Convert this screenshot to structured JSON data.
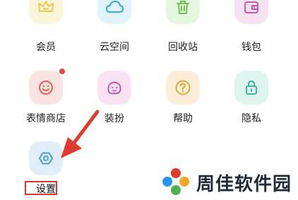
{
  "grid": {
    "row1": [
      {
        "label": "会员",
        "icon": "crown-icon",
        "color": "#e9c84a",
        "bg": "#fbf6d9"
      },
      {
        "label": "云空间",
        "icon": "cloud-icon",
        "color": "#38a7d9",
        "bg": "#e2f4fb"
      },
      {
        "label": "回收站",
        "icon": "trash-icon",
        "color": "#6ec354",
        "bg": "#e6f7df"
      },
      {
        "label": "钱包",
        "icon": "wallet-icon",
        "color": "#c05ab8",
        "bg": "#f6e2f3"
      }
    ],
    "row2": [
      {
        "label": "表情商店",
        "icon": "smiley-icon",
        "color": "#e4605a",
        "bg": "#fbe3e1"
      },
      {
        "label": "装扮",
        "icon": "face-costume-icon",
        "color": "#c35ab2",
        "bg": "#f8e2f3"
      },
      {
        "label": "帮助",
        "icon": "question-icon",
        "color": "#e7a437",
        "bg": "#fcefd9"
      },
      {
        "label": "隐私",
        "icon": "lock-icon",
        "color": "#3fb7a0",
        "bg": "#ddf4ef"
      }
    ],
    "settings": {
      "label": "设置",
      "icon": "settings-hexagon-icon",
      "color": "#4a9fd5",
      "bg": "#e0eef9"
    }
  },
  "overlay": {
    "arrow_color": "#e23b2e",
    "highlight_color": "#d9332b"
  },
  "watermark": {
    "text": "周佳软件园",
    "logo": "pinwheel-logo"
  }
}
